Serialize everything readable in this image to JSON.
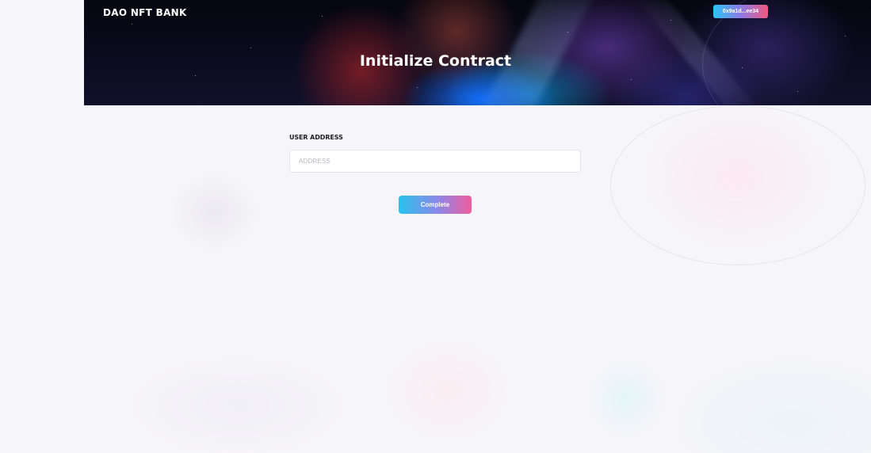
{
  "header": {
    "brand": "DAO NFT BANK",
    "wallet_address": "0x9a1d...ee34",
    "title": "Initialize Contract"
  },
  "form": {
    "user_address": {
      "label": "USER ADDRESS",
      "placeholder": "ADDRESS",
      "value": ""
    },
    "complete_label": "Complete"
  },
  "colors": {
    "gradient_start": "#27c3ef",
    "gradient_mid": "#8f86e8",
    "gradient_end": "#f05d9c",
    "page_background": "#f6f5f9",
    "hero_background": "#0b0a1c"
  }
}
